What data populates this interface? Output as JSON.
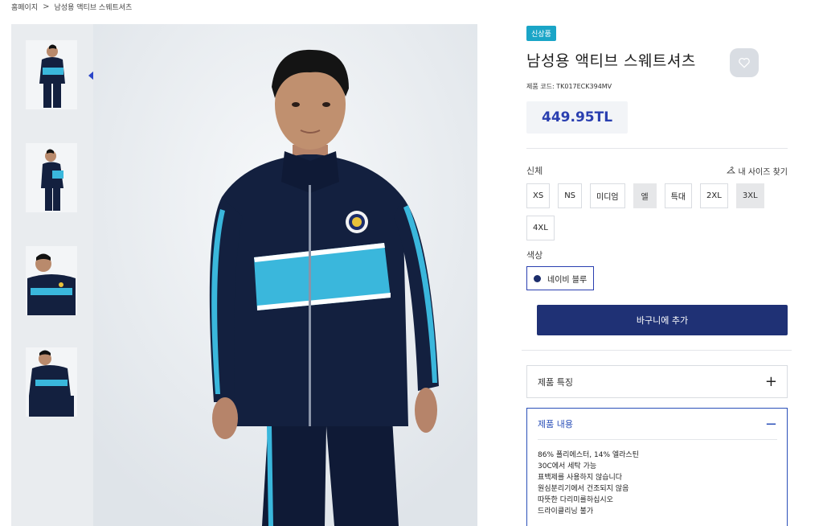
{
  "breadcrumb": {
    "home": "홈페이지",
    "separator": ">",
    "current": "남성용 액티브 스웨트셔츠"
  },
  "product": {
    "badge": "신상품",
    "title": "남성용 액티브 스웨트셔츠",
    "code": "제품 코드: TK017ECK394MV",
    "price": "449.95TL"
  },
  "size": {
    "label": "신체",
    "finder": "내 사이즈 찾기",
    "options": [
      {
        "label": "XS",
        "available": true
      },
      {
        "label": "NS",
        "available": true
      },
      {
        "label": "미디엄",
        "available": true
      },
      {
        "label": "엘",
        "available": false
      },
      {
        "label": "특대",
        "available": true
      },
      {
        "label": "2XL",
        "available": true
      },
      {
        "label": "3XL",
        "available": false
      },
      {
        "label": "4XL",
        "available": true
      }
    ]
  },
  "color": {
    "label": "색상",
    "selected": "네이비 블루",
    "swatch": "#1c2d6b"
  },
  "cart": {
    "add_label": "바구니에 추가"
  },
  "accordion": {
    "features": {
      "title": "제품 특징",
      "sign": "+"
    },
    "content": {
      "title": "제품 내용",
      "sign": "−",
      "lines": [
        "86% 폴리에스터, 14% 엘라스틴",
        "30C에서 세탁 가능",
        "표백제를 사용하지 않습니다",
        "원심분리기에서 건조되지 않음",
        "따뜻한 다리미를하십시오",
        "드라이클리닝 불가"
      ]
    }
  },
  "colors": {
    "accent": "#2a3fb0",
    "button": "#1f3175",
    "badge": "#1aa5c7",
    "jacket": "#13203f",
    "stripe": "#3ab7dc"
  }
}
